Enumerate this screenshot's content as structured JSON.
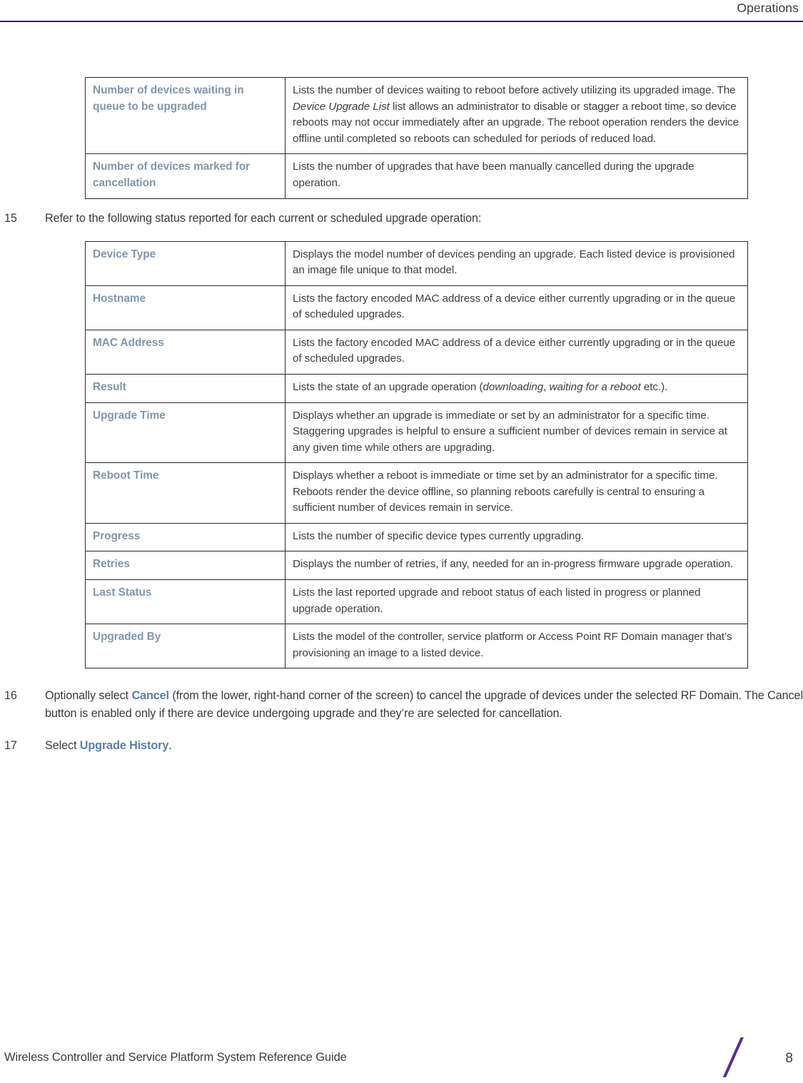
{
  "header": {
    "title": "Operations",
    "rule_color": "#3d1a6e"
  },
  "colors": {
    "term_label": "#7f97ae",
    "ui_reference": "#5b7fa6",
    "accent_purple": "#5b2d8e",
    "body_text": "#3b3b3b",
    "table_border": "#2b2b2b"
  },
  "table_queue_status": {
    "rows": [
      {
        "term": "Number of devices waiting in queue to be upgraded",
        "desc_parts": [
          {
            "text": "Lists the number of devices waiting to reboot before actively utilizing its upgraded image. The ",
            "italic": false
          },
          {
            "text": "Device Upgrade List",
            "italic": true
          },
          {
            "text": " list allows an administrator to disable or stagger a reboot time, so device reboots may not occur immediately after an upgrade. The reboot operation renders the device offline until completed so reboots can scheduled for periods of reduced load.",
            "italic": false
          }
        ]
      },
      {
        "term": "Number of devices marked for cancellation",
        "desc_parts": [
          {
            "text": "Lists the number of upgrades that have been manually cancelled during the upgrade operation.",
            "italic": false
          }
        ]
      }
    ]
  },
  "step_15": {
    "number": "15",
    "text_parts": [
      {
        "text": "Refer to the following status reported for each current or scheduled upgrade operation:",
        "style": "normal"
      }
    ]
  },
  "table_upgrade_status": {
    "rows": [
      {
        "term": "Device Type",
        "desc_parts": [
          {
            "text": "Displays the model number of devices pending an upgrade. Each listed device is provisioned an image file unique to that model.",
            "italic": false
          }
        ]
      },
      {
        "term": "Hostname",
        "desc_parts": [
          {
            "text": "Lists the factory encoded MAC address of a device either currently upgrading or in the queue of scheduled upgrades.",
            "italic": false
          }
        ]
      },
      {
        "term": "MAC Address",
        "desc_parts": [
          {
            "text": "Lists the factory encoded MAC address of a device either currently upgrading or in the queue of scheduled upgrades.",
            "italic": false
          }
        ]
      },
      {
        "term": "Result",
        "desc_parts": [
          {
            "text": "Lists the state of an upgrade operation (",
            "italic": false
          },
          {
            "text": "downloading",
            "italic": true
          },
          {
            "text": ", ",
            "italic": false
          },
          {
            "text": "waiting for a reboot",
            "italic": true
          },
          {
            "text": " etc.).",
            "italic": false
          }
        ]
      },
      {
        "term": "Upgrade Time",
        "desc_parts": [
          {
            "text": "Displays whether an upgrade is immediate or set by an administrator for a specific time. Staggering upgrades is helpful to ensure a sufficient number of devices remain in service at any given time while others are upgrading.",
            "italic": false
          }
        ]
      },
      {
        "term": "Reboot Time",
        "desc_parts": [
          {
            "text": "Displays whether a reboot is immediate or time set by an administrator for a specific time. Reboots render the device offline, so planning reboots carefully is central to ensuring a sufficient number of devices remain in service.",
            "italic": false
          }
        ]
      },
      {
        "term": "Progress",
        "desc_parts": [
          {
            "text": "Lists the number of specific device types currently upgrading.",
            "italic": false
          }
        ]
      },
      {
        "term": "Retries",
        "desc_parts": [
          {
            "text": "Displays the number of retries, if any, needed for an in-progress firmware upgrade operation.",
            "italic": false
          }
        ]
      },
      {
        "term": "Last Status",
        "desc_parts": [
          {
            "text": "Lists the last reported upgrade and reboot status of each listed in progress or planned upgrade operation.",
            "italic": false
          }
        ]
      },
      {
        "term": "Upgraded By",
        "desc_parts": [
          {
            "text": "Lists the model of the controller, service platform or Access Point RF Domain manager that’s provisioning an image to a listed device.",
            "italic": false
          }
        ]
      }
    ]
  },
  "step_16": {
    "number": "16",
    "text_parts": [
      {
        "text": "Optionally select ",
        "style": "normal"
      },
      {
        "text": "Cancel",
        "style": "ui-ref"
      },
      {
        "text": " (from the lower, right-hand corner of the screen) to cancel the upgrade of devices under the selected RF Domain. The Cancel button is enabled only if there are device undergoing upgrade and they’re are selected for cancellation.",
        "style": "normal"
      }
    ]
  },
  "step_17": {
    "number": "17",
    "text_parts": [
      {
        "text": "Select ",
        "style": "normal"
      },
      {
        "text": "Upgrade History",
        "style": "ui-ref"
      },
      {
        "text": ".",
        "style": "normal"
      }
    ]
  },
  "footer": {
    "title": "Wireless Controller and Service Platform System Reference Guide",
    "page_number": "8"
  }
}
